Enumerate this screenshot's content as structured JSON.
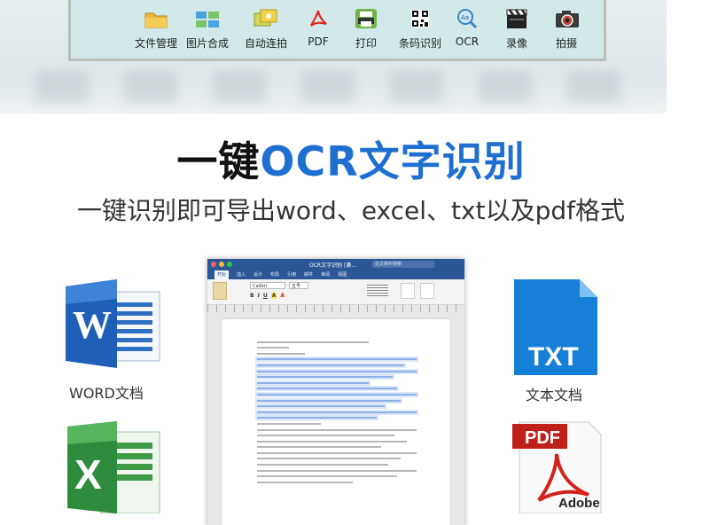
{
  "toolbar": {
    "items": [
      {
        "label": "文件管理",
        "icon": "folder-icon"
      },
      {
        "label": "图片合成",
        "icon": "image-combine-icon"
      },
      {
        "label": "自动连拍",
        "icon": "auto-burst-icon"
      },
      {
        "label": "PDF",
        "icon": "pdf-icon"
      },
      {
        "label": "打印",
        "icon": "printer-icon"
      },
      {
        "label": "条码识别",
        "icon": "barcode-icon"
      },
      {
        "label": "OCR",
        "icon": "ocr-icon"
      },
      {
        "label": "录像",
        "icon": "video-icon"
      },
      {
        "label": "拍摄",
        "icon": "camera-icon"
      }
    ]
  },
  "headline": {
    "prefix": "一键",
    "highlight": "OCR文字识别"
  },
  "subheadline": "一键识别即可导出word、excel、txt以及pdf格式",
  "word_window": {
    "title": "OCR文字识别 [兼...",
    "search_placeholder": "在文档中搜索",
    "tabs": [
      "开始",
      "插入",
      "设计",
      "布局",
      "引用",
      "邮件",
      "审阅",
      "视图"
    ],
    "font": "Calibri",
    "size": "五号"
  },
  "formats": {
    "word": {
      "caption": "WORD文档",
      "icon_letter": "W"
    },
    "txt": {
      "caption": "文本文档",
      "icon_text": "TXT"
    },
    "excel": {
      "icon_letter": "X"
    },
    "pdf": {
      "label": "PDF",
      "brand": "Adobe"
    }
  }
}
